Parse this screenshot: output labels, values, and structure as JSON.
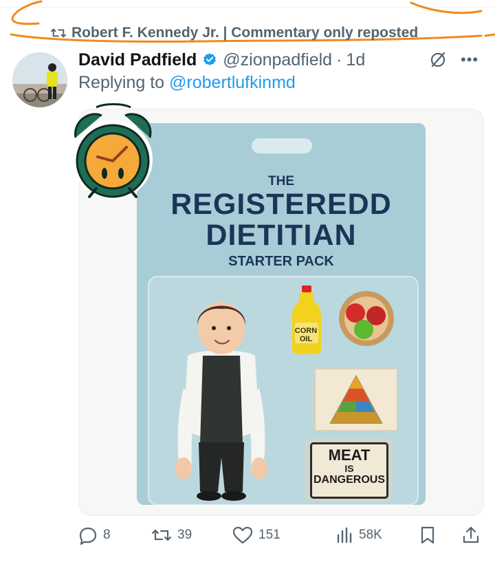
{
  "repost": {
    "label": "Robert F. Kennedy Jr. | Commentary only reposted"
  },
  "tweet": {
    "author_name": "David Padfield",
    "handle": "@zionpadfield",
    "separator": "·",
    "time": "1d",
    "reply_prefix": "Replying to ",
    "reply_to": "@robertlufkinmd"
  },
  "image": {
    "title_small": "THE",
    "title_main": "REGISTEREDD DIETITIAN",
    "title_sub": "STARTER PACK",
    "corn_oil": "CORN OIL",
    "meat_line1": "MEAT",
    "meat_line2": "IS",
    "meat_line3": "DANGEROUS"
  },
  "actions": {
    "replies": "8",
    "reposts": "39",
    "likes": "151",
    "views": "58K"
  },
  "icons": [
    "repost-icon",
    "verified-badge-icon",
    "grok-icon",
    "more-icon",
    "reply-icon",
    "like-icon",
    "views-icon",
    "bookmark-icon",
    "share-icon",
    "alarm-clock-sticker"
  ],
  "colors": {
    "accent": "#1d9bf0",
    "secondary_text": "#536471",
    "annotation": "#f08a1c",
    "card_blue": "#a9cdd6",
    "title_navy": "#1b3558"
  }
}
